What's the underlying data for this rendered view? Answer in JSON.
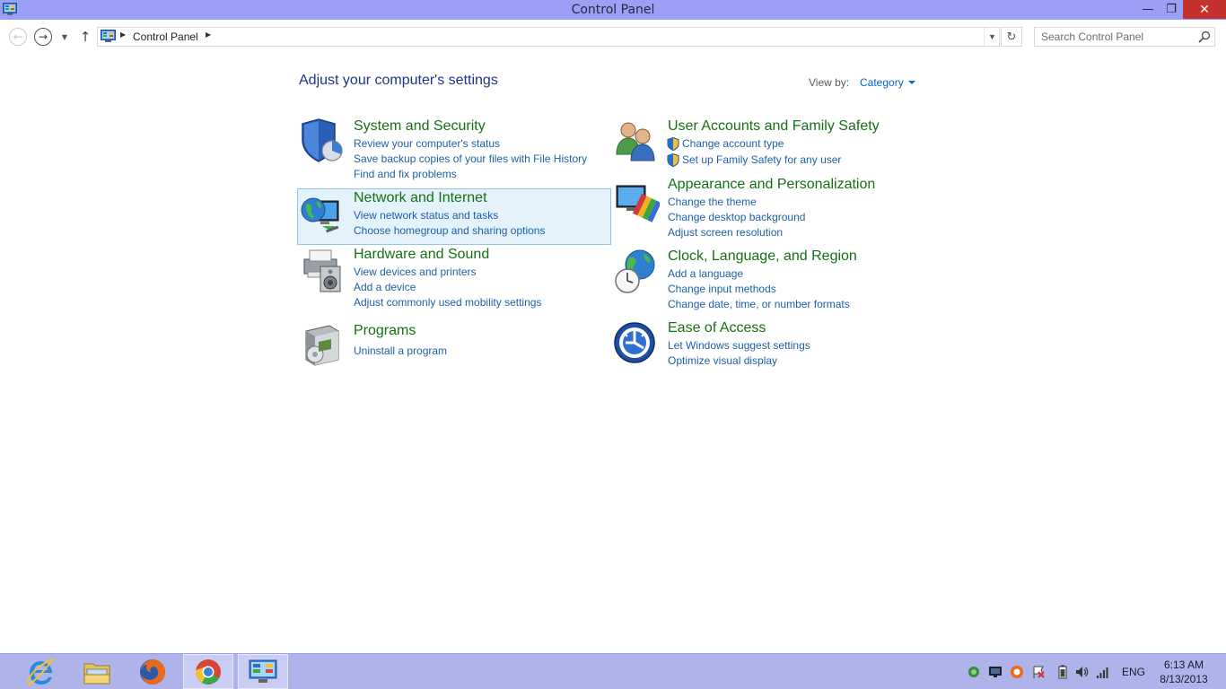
{
  "window": {
    "title": "Control Panel",
    "minimize_label": "—",
    "maximize_label": "❐",
    "close_label": "✕"
  },
  "navigation": {
    "back_icon": "←",
    "forward_icon": "→",
    "recent_icon": "▼",
    "up_icon": "↑",
    "breadcrumb": [
      "Control Panel"
    ],
    "refresh_icon": "↻",
    "dropdown_icon": "▼",
    "search_placeholder": "Search Control Panel"
  },
  "main": {
    "heading": "Adjust your computer's settings",
    "view_by_label": "View by:",
    "view_by_value": "Category"
  },
  "categories": [
    {
      "title": "System and Security",
      "icon": "shield-icon",
      "links": [
        "Review your computer's status",
        "Save backup copies of your files with File History",
        "Find and fix problems"
      ]
    },
    {
      "title": "Network and Internet",
      "icon": "globe-network-icon",
      "links": [
        "View network status and tasks",
        "Choose homegroup and sharing options"
      ]
    },
    {
      "title": "Hardware and Sound",
      "icon": "printer-speaker-icon",
      "links": [
        "View devices and printers",
        "Add a device",
        "Adjust commonly used mobility settings"
      ]
    },
    {
      "title": "Programs",
      "icon": "programs-box-icon",
      "links": [
        "Uninstall a program"
      ]
    },
    {
      "title": "User Accounts and Family Safety",
      "icon": "users-icon",
      "links": [
        "Change account type",
        "Set up Family Safety for any user"
      ]
    },
    {
      "title": "Appearance and Personalization",
      "icon": "monitor-palette-icon",
      "links": [
        "Change the theme",
        "Change desktop background",
        "Adjust screen resolution"
      ]
    },
    {
      "title": "Clock, Language, and Region",
      "icon": "clock-globe-icon",
      "links": [
        "Add a language",
        "Change input methods",
        "Change date, time, or number formats"
      ]
    },
    {
      "title": "Ease of Access",
      "icon": "ease-of-access-icon",
      "links": [
        "Let Windows suggest settings",
        "Optimize visual display"
      ]
    }
  ],
  "taskbar": {
    "apps": [
      "internet-explorer-icon",
      "file-explorer-icon",
      "firefox-icon",
      "chrome-icon",
      "control-panel-icon"
    ],
    "tray_icons": [
      "network-tray-icon",
      "monitor-tray-icon",
      "avast-tray-icon",
      "flag-tray-icon",
      "battery-tray-icon",
      "volume-tray-icon",
      "signal-tray-icon"
    ],
    "language": "ENG",
    "time": "6:13 AM",
    "date": "8/13/2013"
  },
  "colors": {
    "titlebar": "#9b9ff5",
    "taskbar": "#aeb3ea",
    "category_title": "#156f15",
    "link": "#1e5fa8",
    "heading": "#1e3287",
    "close_button": "#c7312d"
  }
}
